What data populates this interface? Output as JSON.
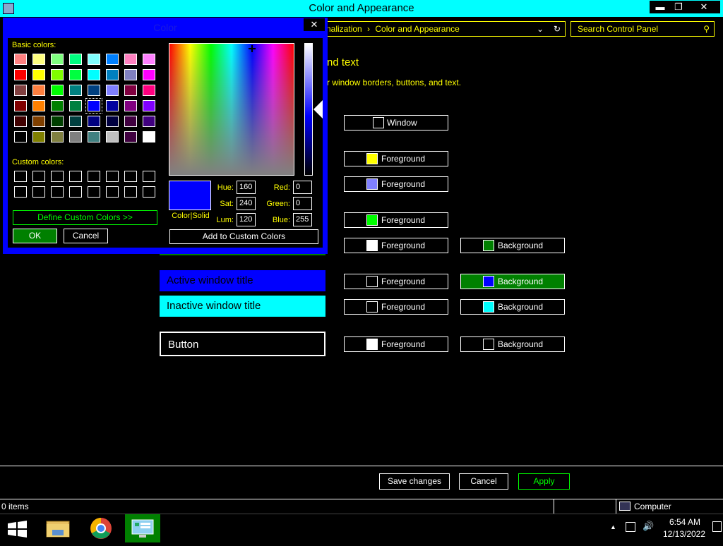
{
  "window": {
    "title": "Color and Appearance",
    "minimize": "▬",
    "maximize": "❐",
    "close": "✕"
  },
  "address": {
    "crumb1": "nalization",
    "sep": "›",
    "crumb2": "Color and Appearance",
    "chevron": "⌄",
    "refresh": "↻"
  },
  "search": {
    "placeholder": "Search Control Panel",
    "icon": "⚲"
  },
  "heading": "nd text",
  "subtext": "r window borders, buttons, and text.",
  "items": {
    "active_title": "Active window title",
    "inactive_title": "Inactive window title",
    "button": "Button"
  },
  "color_buttons": {
    "window": "Window",
    "foreground": "Foreground",
    "background": "Background"
  },
  "swatch_colors": {
    "window": "#000000",
    "fg1": "#ffff00",
    "fg2": "#8080ff",
    "fg3": "#00ff00",
    "fg4": "#ffffff",
    "bg4": "#008000",
    "active_fg": "#000000",
    "active_bg": "#0000ff",
    "inactive_fg": "#000000",
    "inactive_bg": "#00ffff",
    "button_fg": "#ffffff",
    "button_bg": "#000000"
  },
  "bottom": {
    "save": "Save changes",
    "cancel": "Cancel",
    "apply": "Apply"
  },
  "status": {
    "items": "0 items",
    "computer": "Computer"
  },
  "taskbar": {
    "time": "6:54 AM",
    "date": "12/13/2022",
    "tray_up": "▲",
    "volume": "🔊"
  },
  "dialog": {
    "title": "Color",
    "close": "✕",
    "basic_label": "Basic colors:",
    "custom_label": "Custom colors:",
    "define": "Define Custom Colors >>",
    "ok": "OK",
    "cancel": "Cancel",
    "add_custom": "Add to Custom Colors",
    "color_solid": "Color|Solid",
    "fields": {
      "hue_label": "Hue:",
      "hue": "160",
      "sat_label": "Sat:",
      "sat": "240",
      "lum_label": "Lum:",
      "lum": "120",
      "red_label": "Red:",
      "red": "0",
      "green_label": "Green:",
      "green": "0",
      "blue_label": "Blue:",
      "blue": "255"
    },
    "basic_colors": [
      [
        "#ff8080",
        "#ffff80",
        "#80ff80",
        "#00ff80",
        "#80ffff",
        "#0080ff",
        "#ff80c0",
        "#ff80ff"
      ],
      [
        "#ff0000",
        "#ffff00",
        "#80ff00",
        "#00ff40",
        "#00ffff",
        "#0080c0",
        "#8080c0",
        "#ff00ff"
      ],
      [
        "#804040",
        "#ff8040",
        "#00ff00",
        "#008080",
        "#004080",
        "#8080ff",
        "#800040",
        "#ff0080"
      ],
      [
        "#800000",
        "#ff8000",
        "#008000",
        "#008040",
        "#0000ff",
        "#0000a0",
        "#800080",
        "#8000ff"
      ],
      [
        "#400000",
        "#804000",
        "#004000",
        "#004040",
        "#000080",
        "#000040",
        "#400040",
        "#400080"
      ],
      [
        "#000000",
        "#808000",
        "#808040",
        "#808080",
        "#408080",
        "#c0c0c0",
        "#400040",
        "#ffffff"
      ]
    ],
    "selected_row": 3,
    "selected_col": 4
  }
}
